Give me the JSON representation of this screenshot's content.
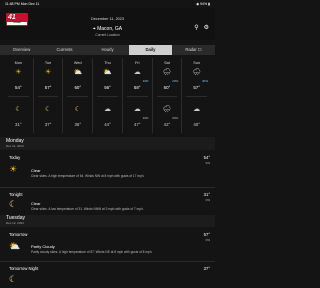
{
  "status": {
    "time": "11:48 PM   Mon Dec 11",
    "right": "◉ 94% ▮"
  },
  "header": {
    "logo_num": "41",
    "logo_sub": "13WMAZ",
    "date": "December 11, 2023",
    "location": "Macon, GA",
    "current_label": "Current Location",
    "pin_icon": "location-pin-icon",
    "settings_icon": "gear-icon"
  },
  "tabs": [
    {
      "label": "Overview"
    },
    {
      "label": "Currents"
    },
    {
      "label": "Hourly"
    },
    {
      "label": "Daily"
    },
    {
      "label": "Radar ☐"
    }
  ],
  "forecast": [
    {
      "day": "Mon",
      "day_icon": "sun-icon",
      "day_glyph": "☀",
      "day_pct": "",
      "hi": "54°",
      "night_icon": "moon-icon",
      "night_glyph": "☾",
      "night_pct": "",
      "lo": "31°"
    },
    {
      "day": "Tue",
      "day_icon": "sun-icon",
      "day_glyph": "☀",
      "day_pct": "",
      "hi": "57°",
      "night_icon": "moon-icon",
      "night_glyph": "☾",
      "night_pct": "",
      "lo": "37°"
    },
    {
      "day": "Wed",
      "day_icon": "partly-sunny-icon",
      "day_glyph": "⛅",
      "day_pct": "",
      "hi": "60°",
      "night_icon": "moon-icon",
      "night_glyph": "☾",
      "night_pct": "",
      "lo": "36°"
    },
    {
      "day": "Thu",
      "day_icon": "partly-sunny-icon",
      "day_glyph": "⛅",
      "day_pct": "",
      "hi": "56°",
      "night_icon": "cloud-icon",
      "night_glyph": "☁",
      "night_pct": "",
      "lo": "44°"
    },
    {
      "day": "Fri",
      "day_icon": "cloud-icon",
      "day_glyph": "☁",
      "day_pct": "10%",
      "hi": "58°",
      "night_icon": "cloud-icon",
      "night_glyph": "☁",
      "night_pct": "20%",
      "lo": "47°"
    },
    {
      "day": "Sat",
      "day_icon": "rain-icon",
      "day_glyph": "🌧",
      "day_pct": "20%",
      "hi": "60°",
      "night_icon": "rain-icon",
      "night_glyph": "🌧",
      "night_pct": "60%",
      "lo": "42°"
    },
    {
      "day": "Sun",
      "day_icon": "rain-icon",
      "day_glyph": "🌧",
      "day_pct": "40%",
      "hi": "57°",
      "night_icon": "cloud-icon",
      "night_glyph": "☁",
      "night_pct": "",
      "lo": "40°"
    }
  ],
  "details": {
    "day1": {
      "title": "Monday",
      "date": "Dec 11, 2023"
    },
    "today": {
      "label": "Today",
      "temp": "54°",
      "pct": "0%",
      "condition": "Clear",
      "desc": "Clear skies. A high temperature of 54. Winds NW at 8 mph with gusts of 17 mph."
    },
    "tonight": {
      "label": "Tonight",
      "temp": "31°",
      "pct": "0%",
      "condition": "Clear",
      "desc": "Clear skies. A low temperature of 31. Winds NNW at 3 mph with gusts of 7 mph."
    },
    "day2": {
      "title": "Tuesday",
      "date": "Dec 12, 2023"
    },
    "tomorrow": {
      "label": "Tomorrow",
      "temp": "57°",
      "pct": "0%",
      "condition": "Partly Cloudy",
      "desc": "Partly cloudy skies. A high temperature of 57. Winds NE at 8 mph with gusts of 8 mph."
    },
    "tomorrow_night": {
      "label": "Tomorrow Night",
      "temp": "37°"
    }
  }
}
